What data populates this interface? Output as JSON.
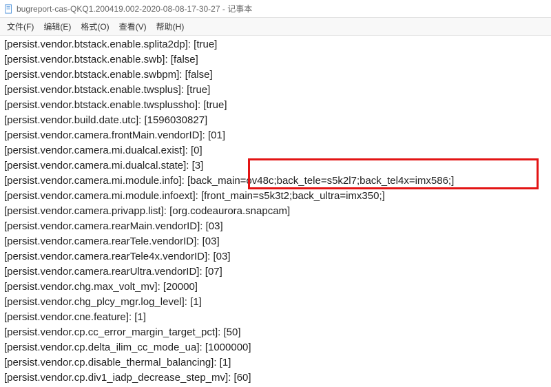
{
  "window": {
    "title": "bugreport-cas-QKQ1.200419.002-2020-08-08-17-30-27 - 记事本"
  },
  "menu": {
    "file": "文件(F)",
    "edit": "编辑(E)",
    "format": "格式(O)",
    "view": "查看(V)",
    "help": "帮助(H)"
  },
  "lines": {
    "l0": "[persist.vendor.btstack.enable.splita2dp]: [true]",
    "l1": "[persist.vendor.btstack.enable.swb]: [false]",
    "l2": "[persist.vendor.btstack.enable.swbpm]: [false]",
    "l3": "[persist.vendor.btstack.enable.twsplus]: [true]",
    "l4": "[persist.vendor.btstack.enable.twsplussho]: [true]",
    "l5": "[persist.vendor.build.date.utc]: [1596030827]",
    "l6": "[persist.vendor.camera.frontMain.vendorID]: [01]",
    "l7": "[persist.vendor.camera.mi.dualcal.exist]: [0]",
    "l8": "[persist.vendor.camera.mi.dualcal.state]: [3]",
    "l9": "[persist.vendor.camera.mi.module.info]: [back_main=ov48c;back_tele=s5k2l7;back_tel4x=imx586;]",
    "l10": "[persist.vendor.camera.mi.module.infoext]: [front_main=s5k3t2;back_ultra=imx350;]",
    "l11": "[persist.vendor.camera.privapp.list]: [org.codeaurora.snapcam]",
    "l12": "[persist.vendor.camera.rearMain.vendorID]: [03]",
    "l13": "[persist.vendor.camera.rearTele.vendorID]: [03]",
    "l14": "[persist.vendor.camera.rearTele4x.vendorID]: [03]",
    "l15": "[persist.vendor.camera.rearUltra.vendorID]: [07]",
    "l16": "[persist.vendor.chg.max_volt_mv]: [20000]",
    "l17": "[persist.vendor.chg_plcy_mgr.log_level]: [1]",
    "l18": "[persist.vendor.cne.feature]: [1]",
    "l19": "[persist.vendor.cp.cc_error_margin_target_pct]: [50]",
    "l20": "[persist.vendor.cp.delta_ilim_cc_mode_ua]: [1000000]",
    "l21": "[persist.vendor.cp.disable_thermal_balancing]: [1]",
    "l22": "[persist.vendor.cp.div1_iadp_decrease_step_mv]: [60]"
  }
}
